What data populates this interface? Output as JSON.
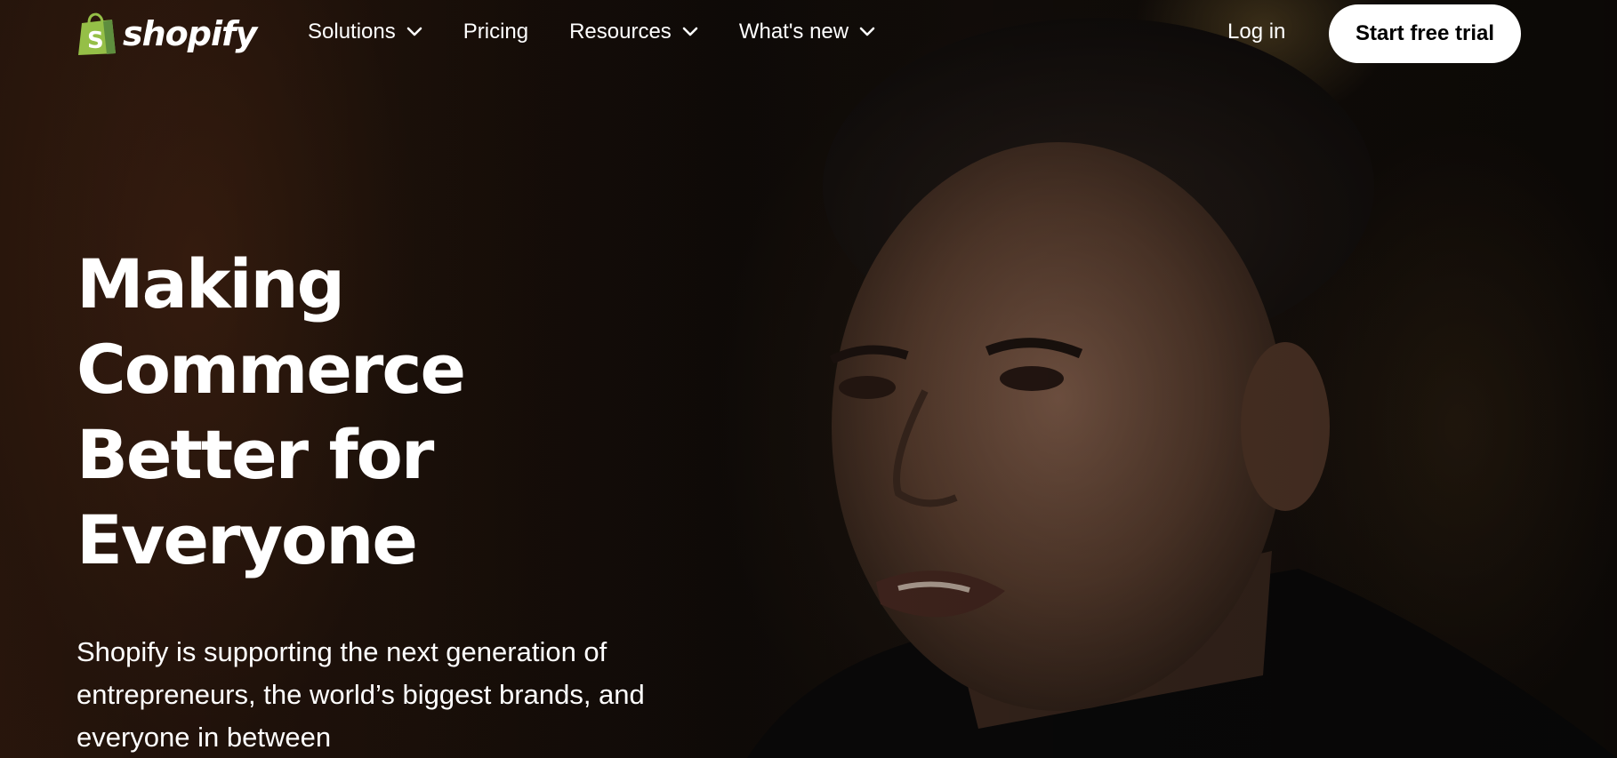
{
  "brand": {
    "name": "shopify",
    "logo_color": "#95BF47"
  },
  "nav": {
    "items": [
      {
        "label": "Solutions",
        "has_dropdown": true
      },
      {
        "label": "Pricing",
        "has_dropdown": false
      },
      {
        "label": "Resources",
        "has_dropdown": true
      },
      {
        "label": "What's new",
        "has_dropdown": true
      }
    ],
    "login_label": "Log in",
    "cta_label": "Start free trial"
  },
  "hero": {
    "headline_lines": [
      "Making",
      "Commerce",
      "Better for",
      "Everyone"
    ],
    "subtext": "Shopify is supporting the next generation of entrepreneurs, the world’s biggest brands, and everyone in between",
    "background": "video of a man speaking",
    "text_color": "#ffffff"
  },
  "icons": [
    "shopify-bag-icon",
    "chevron-down-icon"
  ]
}
